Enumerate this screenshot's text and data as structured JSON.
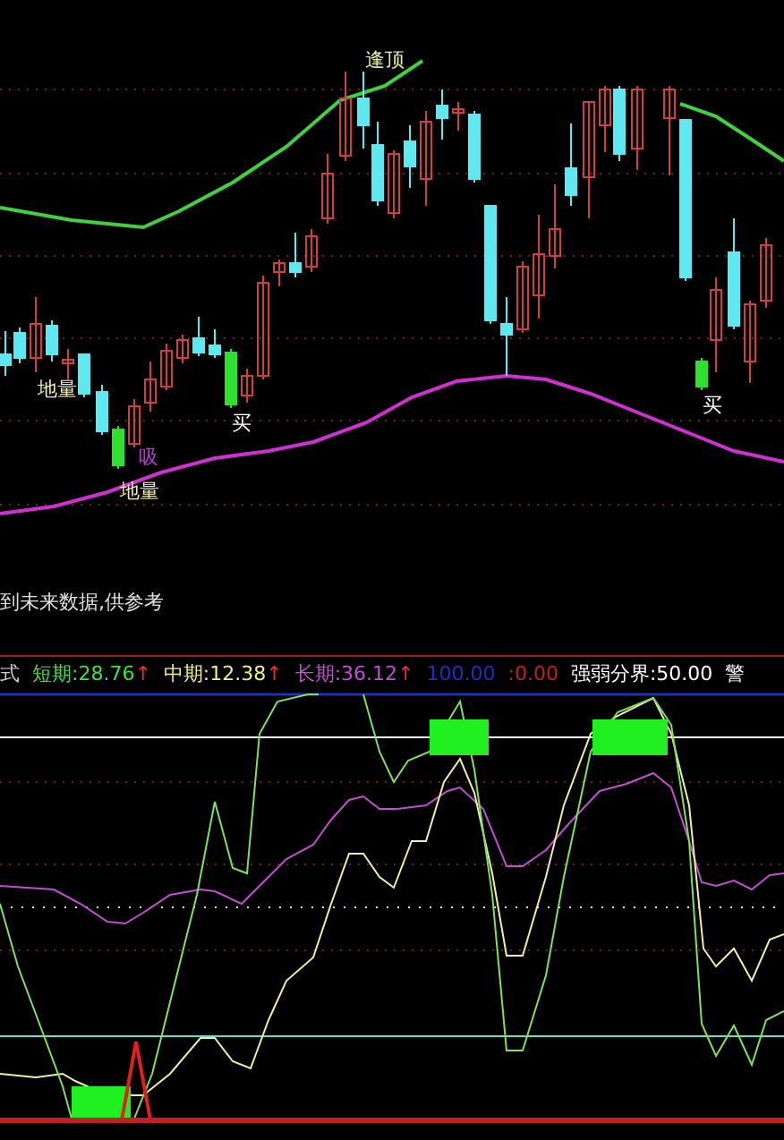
{
  "price_chart": {
    "labels": [
      {
        "text": "逢顶",
        "color": "#e6f0a0"
      },
      {
        "text": "地量",
        "color": "#f5f0b0"
      },
      {
        "text": "吸",
        "color": "#b040d0"
      },
      {
        "text": "地量",
        "color": "#f5f0b0"
      },
      {
        "text": "买",
        "color": "#ffffff"
      },
      {
        "text": "买",
        "color": "#ffffff"
      }
    ]
  },
  "notice": "到未来数据,供参考",
  "indicator_header": [
    {
      "text": "式",
      "color": "#d0d0d0"
    },
    {
      "text": "短期:28.76",
      "arrow": "↑",
      "color": "#40e040"
    },
    {
      "text": "中期:12.38",
      "arrow": "↑",
      "color": "#f0f080"
    },
    {
      "text": "长期:36.12",
      "arrow": "↑",
      "color": "#c050d0"
    },
    {
      "text": "100.00",
      "color": "#2030c0"
    },
    {
      "text": ":0.00",
      "color": "#c02020"
    },
    {
      "text": "强弱分界:50.00",
      "color": "#ffffff"
    },
    {
      "text": "警",
      "color": "#ffffff"
    }
  ]
}
